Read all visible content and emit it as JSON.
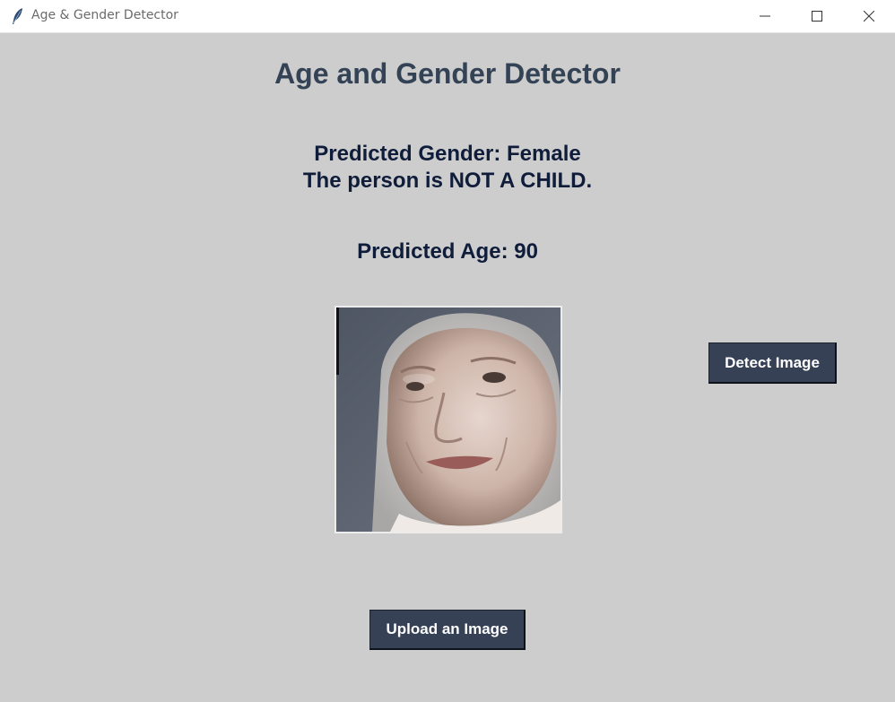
{
  "window": {
    "title": "Age & Gender Detector",
    "icon": "feather-icon",
    "controls": [
      "minimize-icon",
      "maximize-icon",
      "close-icon"
    ]
  },
  "app": {
    "heading": "Age and Gender Detector",
    "gender_text": "Predicted Gender: Female",
    "child_text": "The person is NOT A CHILD.",
    "age_text": "Predicted Age: 90",
    "detect_button": "Detect Image",
    "upload_button": "Upload an Image"
  },
  "colors": {
    "background": "#cdcdcd",
    "heading": "#344255",
    "result_text": "#0f1d3a",
    "button_bg": "#364156",
    "button_text": "#ffffff"
  }
}
